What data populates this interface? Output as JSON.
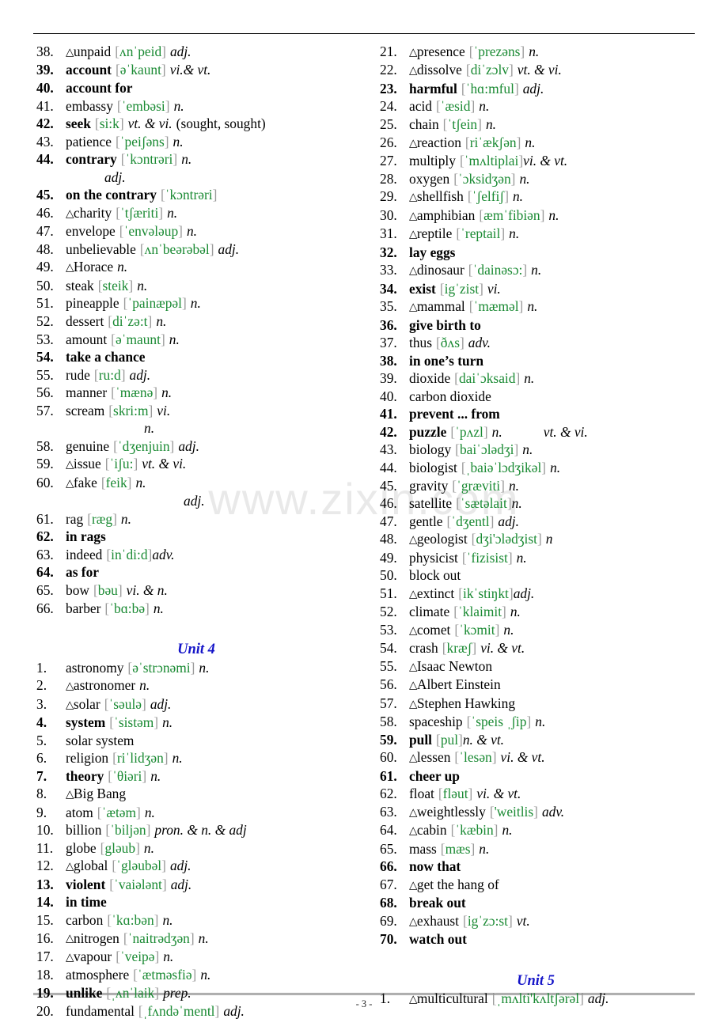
{
  "page": {
    "footer": "- 3 -",
    "watermark": "www.zixin.com",
    "accent_green": "#1a8a33",
    "bracket_gray": "#9a9a9a",
    "unit_blue": "#1414c8"
  },
  "left_column": {
    "entries": [
      {
        "num": "38.",
        "tri": true,
        "word": "unpaid",
        "phon": "ʌnˈpeid",
        "pos": "adj.",
        "bold": false
      },
      {
        "num": "39.",
        "tri": false,
        "word": "account",
        "phon": "əˈkaunt",
        "pos": "vi.& vt.",
        "bold": true
      },
      {
        "num": "40.",
        "tri": false,
        "word": "account for",
        "phon": "",
        "pos": "",
        "bold": true
      },
      {
        "num": "41.",
        "tri": false,
        "word": "embassy",
        "phon": "ˈembəsi",
        "pos": "n.",
        "bold": false
      },
      {
        "num": "42.",
        "tri": false,
        "word": "seek",
        "phon": "si:k",
        "pos": "vt. & vi.",
        "tail": "(sought, sought)",
        "bold": true
      },
      {
        "num": "43.",
        "tri": false,
        "word": "patience",
        "phon": "ˈpeiʃəns",
        "pos": "n.",
        "bold": false
      },
      {
        "num": "44.",
        "tri": false,
        "word": "contrary",
        "phon": "ˈkɔntrəri",
        "pos": "n.",
        "bold": true,
        "cont": "adj.",
        "cont_indent": 1
      },
      {
        "num": "45.",
        "tri": false,
        "word": "on the contrary",
        "phon": "ˈkɔntrəri",
        "pos": "",
        "bold": true
      },
      {
        "num": "46.",
        "tri": true,
        "word": "charity",
        "phon": "ˈtʃæriti",
        "pos": "n.",
        "bold": false
      },
      {
        "num": "47.",
        "tri": false,
        "word": "envelope",
        "phon": "ˈenvələup",
        "pos": "n.",
        "bold": false
      },
      {
        "num": "48.",
        "tri": false,
        "word": "unbelievable",
        "phon": "ʌnˈbeərəbəl",
        "pos": "adj.",
        "bold": false
      },
      {
        "num": "49.",
        "tri": true,
        "word": "Horace",
        "phon": "",
        "pos": "n.",
        "bold": false
      },
      {
        "num": "50.",
        "tri": false,
        "word": "steak",
        "phon": "steik",
        "pos": "n.",
        "bold": false
      },
      {
        "num": "51.",
        "tri": false,
        "word": "pineapple",
        "phon": "ˈpainæpəl",
        "pos": "n.",
        "bold": false
      },
      {
        "num": "52.",
        "tri": false,
        "word": "dessert",
        "phon": "diˈzə:t",
        "pos": "n.",
        "bold": false
      },
      {
        "num": "53.",
        "tri": false,
        "word": "amount",
        "phon": "əˈmaunt",
        "pos": "n.",
        "bold": false
      },
      {
        "num": "54.",
        "tri": false,
        "word": "take a chance",
        "phon": "",
        "pos": "",
        "bold": true
      },
      {
        "num": "55.",
        "tri": false,
        "word": "rude",
        "phon": "ru:d",
        "pos": "adj.",
        "bold": false
      },
      {
        "num": "56.",
        "tri": false,
        "word": "manner",
        "phon": "ˈmænə",
        "pos": "n.",
        "bold": false
      },
      {
        "num": "57.",
        "tri": false,
        "word": "scream",
        "phon": "skri:m",
        "pos": "vi.",
        "bold": false,
        "cont": "n.",
        "cont_indent": 2
      },
      {
        "num": "58.",
        "tri": false,
        "word": "genuine",
        "phon": "ˈdʒenjuin",
        "pos": "adj.",
        "bold": false
      },
      {
        "num": "59.",
        "tri": true,
        "word": "issue",
        "phon": "ˈiʃu:",
        "pos": "vt. & vi.",
        "bold": false
      },
      {
        "num": "60.",
        "tri": true,
        "word": "fake",
        "phon": "feik",
        "pos": "n.",
        "bold": false,
        "cont": "adj.",
        "cont_indent": 3
      },
      {
        "num": "61.",
        "tri": false,
        "word": "rag",
        "phon": "ræg",
        "pos": "n.",
        "bold": false
      },
      {
        "num": "62.",
        "tri": false,
        "word": "in rags",
        "phon": "",
        "pos": "",
        "bold": true
      },
      {
        "num": "63.",
        "tri": false,
        "word": "indeed",
        "phon": "inˈdi:d",
        "pos": "adv.",
        "bold": false,
        "tight": true
      },
      {
        "num": "64.",
        "tri": false,
        "word": "as for",
        "phon": "",
        "pos": "",
        "bold": true
      },
      {
        "num": "65.",
        "tri": false,
        "word": "bow",
        "phon": "bəu",
        "pos": "vi. & n.",
        "bold": false
      },
      {
        "num": "66.",
        "tri": false,
        "word": "barber",
        "phon": "ˈbɑ:bə",
        "pos": "n.",
        "bold": false
      }
    ],
    "unit_heading": "Unit 4",
    "unit_entries": [
      {
        "num": "1.",
        "tri": false,
        "word": "astronomy",
        "phon": "əˈstrɔnəmi",
        "pos": "n.",
        "bold": false
      },
      {
        "num": "2.",
        "tri": true,
        "word": "astronomer",
        "phon": "",
        "pos": "n.",
        "bold": false
      },
      {
        "num": "3.",
        "tri": true,
        "word": "solar",
        "phon": "ˈsəulə",
        "pos": "adj.",
        "bold": false
      },
      {
        "num": "4.",
        "tri": false,
        "word": "system",
        "phon": "ˈsistəm",
        "pos": "n.",
        "bold": true
      },
      {
        "num": "5.",
        "tri": false,
        "word": "solar system",
        "phon": "",
        "pos": "",
        "bold": false
      },
      {
        "num": "6.",
        "tri": false,
        "word": "religion",
        "phon": "riˈlidʒən",
        "pos": "n.",
        "bold": false
      },
      {
        "num": "7.",
        "tri": false,
        "word": "theory",
        "phon": "ˈθiəri",
        "pos": "n.",
        "bold": true
      },
      {
        "num": "8.",
        "tri": true,
        "word": "Big Bang",
        "phon": "",
        "pos": "",
        "bold": false
      },
      {
        "num": "9.",
        "tri": false,
        "word": "atom",
        "phon": "ˈætəm",
        "pos": "n.",
        "bold": false
      },
      {
        "num": "10.",
        "tri": false,
        "word": "billion",
        "phon": "ˈbiljən",
        "pos": "pron. & n. & adj",
        "bold": false
      },
      {
        "num": "11.",
        "tri": false,
        "word": "globe",
        "phon": "gləub",
        "pos": "n.",
        "bold": false
      },
      {
        "num": "12.",
        "tri": true,
        "word": "global",
        "phon": "ˈgləubəl",
        "pos": "adj.",
        "bold": false
      },
      {
        "num": "13.",
        "tri": false,
        "word": "violent",
        "phon": "ˈvaiələnt",
        "pos": "adj.",
        "bold": true
      },
      {
        "num": "14.",
        "tri": false,
        "word": "in time",
        "phon": "",
        "pos": "",
        "bold": true
      },
      {
        "num": "15.",
        "tri": false,
        "word": "carbon",
        "phon": "ˈkɑ:bən",
        "pos": "n.",
        "bold": false
      },
      {
        "num": "16.",
        "tri": true,
        "word": "nitrogen",
        "phon": "ˈnaitrədʒən",
        "pos": "n.",
        "bold": false
      },
      {
        "num": "17.",
        "tri": true,
        "word": "vapour",
        "phon": "ˈveipə",
        "pos": "n.",
        "bold": false
      },
      {
        "num": "18.",
        "tri": false,
        "word": "atmosphere",
        "phon": "ˈætməsfiə",
        "pos": "n.",
        "bold": false
      },
      {
        "num": "19.",
        "tri": false,
        "word": "unlike",
        "phon": "ˌʌnˈlaik",
        "pos": "prep.",
        "bold": true,
        "gap": true
      },
      {
        "num": "20.",
        "tri": false,
        "word": "fundamental",
        "phon": "ˌfʌndəˈmentl",
        "pos": "adj.",
        "bold": false
      }
    ]
  },
  "right_column": {
    "entries": [
      {
        "num": "21.",
        "tri": true,
        "word": "presence",
        "phon": "ˈprezəns",
        "pos": "n.",
        "bold": false
      },
      {
        "num": "22.",
        "tri": true,
        "word": "dissolve",
        "phon": "diˈzɔlv",
        "pos": "vt. & vi.",
        "bold": false
      },
      {
        "num": "23.",
        "tri": false,
        "word": "harmful",
        "phon": "ˈhɑ:mful",
        "pos": "adj.",
        "bold": true
      },
      {
        "num": "24.",
        "tri": false,
        "word": "acid",
        "phon": "ˈæsid",
        "pos": "n.",
        "bold": false
      },
      {
        "num": "25.",
        "tri": false,
        "word": "chain",
        "phon": "ˈtʃein",
        "pos": "n.",
        "bold": false
      },
      {
        "num": "26.",
        "tri": true,
        "word": "reaction",
        "phon": "riˈækʃən",
        "pos": "n.",
        "bold": false
      },
      {
        "num": "27.",
        "tri": false,
        "word": "multiply",
        "phon": "ˈmʌltiplai",
        "pos": "vi. & vt.",
        "bold": false,
        "tight": true
      },
      {
        "num": "28.",
        "tri": false,
        "word": "oxygen",
        "phon": "ˈɔksidʒən",
        "pos": "n.",
        "bold": false
      },
      {
        "num": "29.",
        "tri": true,
        "word": "shellfish",
        "phon": "ˈʃelfiʃ",
        "pos": "n.",
        "bold": false
      },
      {
        "num": "30.",
        "tri": true,
        "word": "amphibian",
        "phon": "æmˈfibiən",
        "pos": "n.",
        "bold": false
      },
      {
        "num": "31.",
        "tri": true,
        "word": "reptile",
        "phon": "ˈreptail",
        "pos": "n.",
        "bold": false
      },
      {
        "num": "32.",
        "tri": false,
        "word": "lay eggs",
        "phon": "",
        "pos": "",
        "bold": true
      },
      {
        "num": "33.",
        "tri": true,
        "word": "dinosaur",
        "phon": "ˈdainəsɔ:",
        "pos": "n.",
        "bold": false
      },
      {
        "num": "34.",
        "tri": false,
        "word": "exist",
        "phon": "igˈzist",
        "pos": "vi.",
        "bold": true
      },
      {
        "num": "35.",
        "tri": true,
        "word": "mammal",
        "phon": "ˈmæməl",
        "pos": "n.",
        "bold": false
      },
      {
        "num": "36.",
        "tri": false,
        "word": "give birth to",
        "phon": "",
        "pos": "",
        "bold": true
      },
      {
        "num": "37.",
        "tri": false,
        "word": "thus",
        "phon": "ðʌs",
        "pos": "adv.",
        "bold": false
      },
      {
        "num": "38.",
        "tri": false,
        "word": "in one’s turn",
        "phon": "",
        "pos": "",
        "bold": true
      },
      {
        "num": "39.",
        "tri": false,
        "word": "dioxide",
        "phon": "daiˈɔksaid",
        "pos": "n.",
        "bold": false
      },
      {
        "num": "40.",
        "tri": false,
        "word": "carbon dioxide",
        "phon": "",
        "pos": "",
        "bold": false
      },
      {
        "num": "41.",
        "tri": false,
        "word": "prevent ... from",
        "phon": "",
        "pos": "",
        "bold": true
      },
      {
        "num": "42.",
        "tri": false,
        "word": "puzzle",
        "phon": "ˈpʌzl",
        "pos": "n.",
        "bold": true,
        "pos2": "vt. & vi."
      },
      {
        "num": "43.",
        "tri": false,
        "word": "biology",
        "phon": "baiˈɔlədʒi",
        "pos": "n.",
        "bold": false
      },
      {
        "num": "44.",
        "tri": false,
        "word": "biologist",
        "phon": "ˌbaiəˈlɔdʒikəl",
        "pos": "n.",
        "bold": false
      },
      {
        "num": "45.",
        "tri": false,
        "word": "gravity",
        "phon": "ˈgræviti",
        "pos": "n.",
        "bold": false
      },
      {
        "num": "46.",
        "tri": false,
        "word": "satellite",
        "phon": "ˈsætəlait",
        "pos": "n.",
        "bold": false,
        "tight": true
      },
      {
        "num": "47.",
        "tri": false,
        "word": "gentle",
        "phon": "ˈdʒentl",
        "pos": "adj.",
        "bold": false
      },
      {
        "num": "48.",
        "tri": true,
        "word": "geologist",
        "phon": "dʒi'ɔlədʒist",
        "pos": "n",
        "bold": false
      },
      {
        "num": "49.",
        "tri": false,
        "word": "physicist",
        "phon": "ˈfizisist",
        "pos": "n.",
        "bold": false
      },
      {
        "num": "50.",
        "tri": false,
        "word": "block out",
        "phon": "",
        "pos": "",
        "bold": false
      },
      {
        "num": "51.",
        "tri": true,
        "word": "extinct",
        "phon": "ikˈstiŋkt",
        "pos": "adj.",
        "bold": false,
        "tight": true
      },
      {
        "num": "52.",
        "tri": false,
        "word": "climate",
        "phon": "ˈklaimit",
        "pos": "n.",
        "bold": false
      },
      {
        "num": "53.",
        "tri": true,
        "word": "comet",
        "phon": "ˈkɔmit",
        "pos": "n.",
        "bold": false
      },
      {
        "num": "54.",
        "tri": false,
        "word": "crash",
        "phon": "kræʃ",
        "pos": "vi. & vt.",
        "bold": false
      },
      {
        "num": "55.",
        "tri": true,
        "word": "Isaac Newton",
        "phon": "",
        "pos": "",
        "bold": false
      },
      {
        "num": "56.",
        "tri": true,
        "word": "Albert Einstein",
        "phon": "",
        "pos": "",
        "bold": false
      },
      {
        "num": "57.",
        "tri": true,
        "word": "Stephen Hawking",
        "phon": "",
        "pos": "",
        "bold": false
      },
      {
        "num": "58.",
        "tri": false,
        "word": "spaceship",
        "phon": "ˈspeis ˌʃip",
        "pos": "n.",
        "bold": false
      },
      {
        "num": "59.",
        "tri": false,
        "word": "pull",
        "phon": "pul",
        "pos": "n. & vt.",
        "bold": true,
        "tight": true
      },
      {
        "num": "60.",
        "tri": true,
        "word": "lessen",
        "phon": "ˈlesən",
        "pos": "vi. & vt.",
        "bold": false
      },
      {
        "num": "61.",
        "tri": false,
        "word": "cheer up",
        "phon": "",
        "pos": "",
        "bold": true
      },
      {
        "num": "62.",
        "tri": false,
        "word": "float",
        "phon": "fləut",
        "pos": "vi. & vt.",
        "bold": false
      },
      {
        "num": "63.",
        "tri": true,
        "word": "weightlessly",
        "phon": "'weitlis",
        "pos": "adv.",
        "bold": false
      },
      {
        "num": "64.",
        "tri": true,
        "word": "cabin",
        "phon": "ˈkæbin",
        "pos": "n.",
        "bold": false
      },
      {
        "num": "65.",
        "tri": false,
        "word": "mass",
        "phon": "mæs",
        "pos": "n.",
        "bold": false
      },
      {
        "num": "66.",
        "tri": false,
        "word": "now that",
        "phon": "",
        "pos": "",
        "bold": true
      },
      {
        "num": "67.",
        "tri": true,
        "word": "get the hang of",
        "phon": "",
        "pos": "",
        "bold": false
      },
      {
        "num": "68.",
        "tri": false,
        "word": "break out",
        "phon": "",
        "pos": "",
        "bold": true
      },
      {
        "num": "69.",
        "tri": true,
        "word": "exhaust",
        "phon": "igˈzɔ:st",
        "pos": "vt.",
        "bold": false
      },
      {
        "num": "70.",
        "tri": false,
        "word": "watch out",
        "phon": "",
        "pos": "",
        "bold": true
      }
    ],
    "unit_heading": "Unit 5",
    "unit_entries": [
      {
        "num": "1.",
        "tri": true,
        "word": "multicultural",
        "phon": "ˌmʌlti'kʌltʃərəl",
        "pos": "adj.",
        "bold": false
      }
    ]
  }
}
